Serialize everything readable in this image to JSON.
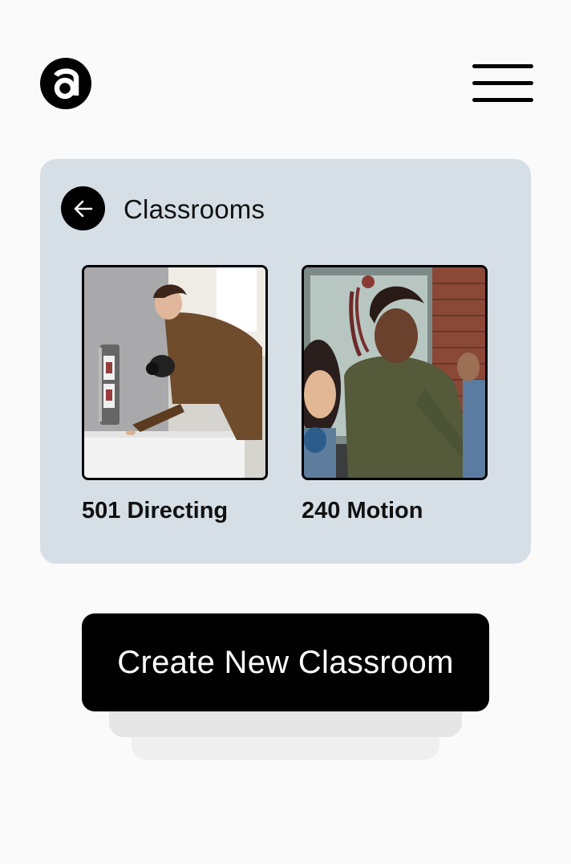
{
  "header": {
    "logo_icon": "letter-a-logo",
    "menu_icon": "hamburger-menu-icon"
  },
  "classrooms": {
    "title": "Classrooms",
    "back_icon": "arrow-left-icon",
    "items": [
      {
        "label": "501 Directing",
        "image": "photographer-with-camera-at-desk"
      },
      {
        "label": "240 Motion",
        "image": "woman-in-green-sweater-presenting"
      }
    ]
  },
  "actions": {
    "create_label": "Create New Classroom"
  },
  "colors": {
    "panel_bg": "#d6dfe6",
    "button_bg": "#000000",
    "button_text": "#ffffff"
  }
}
